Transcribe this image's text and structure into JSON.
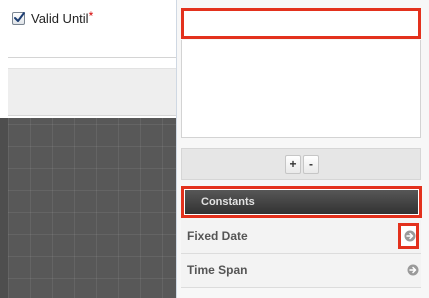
{
  "field": {
    "label": "Valid Until",
    "required_mark": "*",
    "checked": true
  },
  "formula": {
    "search_value": "",
    "formula_value": "",
    "operators": [
      "+",
      "-"
    ]
  },
  "constants": {
    "header": "Constants",
    "items": [
      {
        "label": "Fixed Date",
        "icon": "arrow-right-circle-icon"
      },
      {
        "label": "Time Span",
        "icon": "arrow-right-circle-icon"
      }
    ]
  },
  "colors": {
    "highlight": "#e3311d",
    "grid_bg": "#585858",
    "header_bg": "#3f3f3f"
  }
}
